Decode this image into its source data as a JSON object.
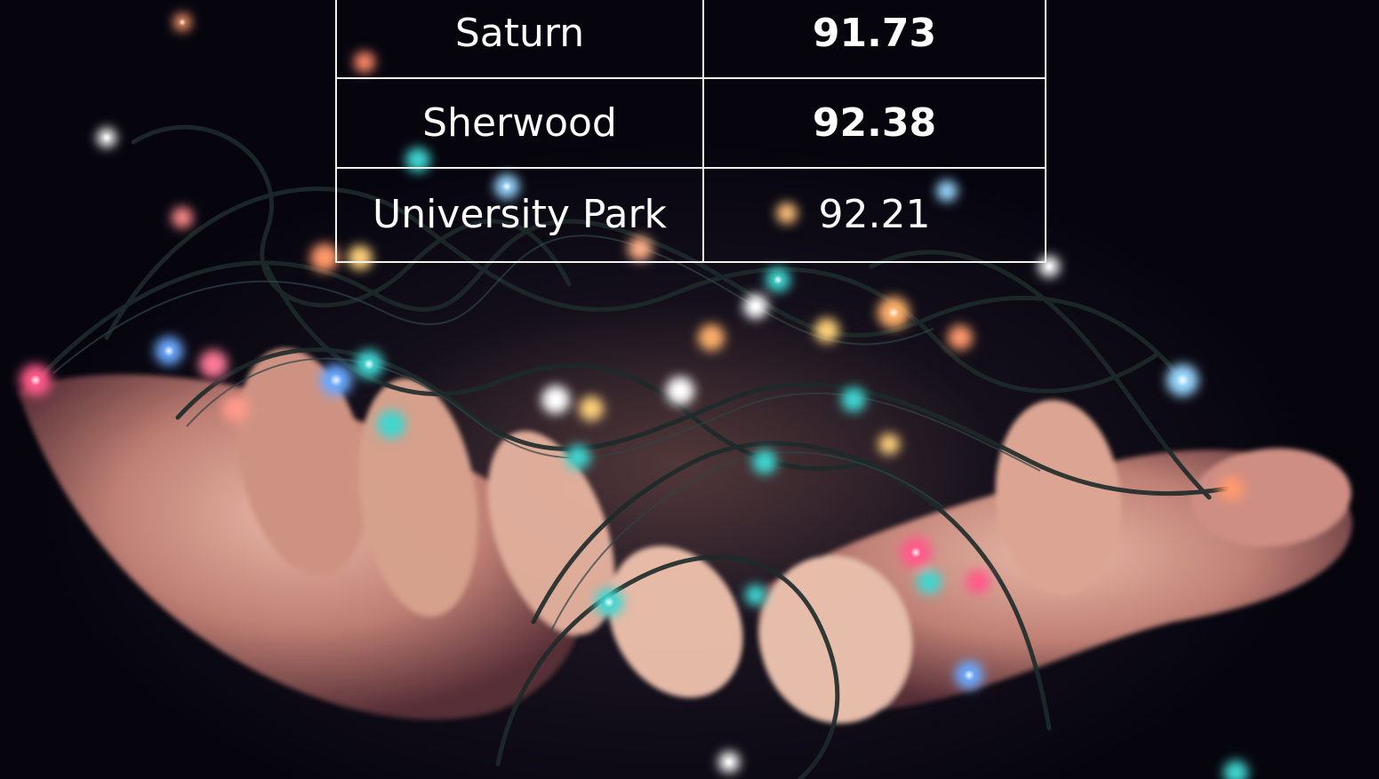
{
  "table": {
    "rows": [
      {
        "name": "Saturn",
        "value": "91.73",
        "bold": true
      },
      {
        "name": "Sherwood",
        "value": "92.38",
        "bold": true
      },
      {
        "name": "University Park",
        "value": "92.21",
        "bold": false
      }
    ]
  },
  "background": {
    "subject": "hands-holding-string-lights-photo",
    "light_colors": [
      "#3fd6d0",
      "#ff9a6a",
      "#ff5a8a",
      "#ffd27a",
      "#6aa8ff"
    ]
  }
}
